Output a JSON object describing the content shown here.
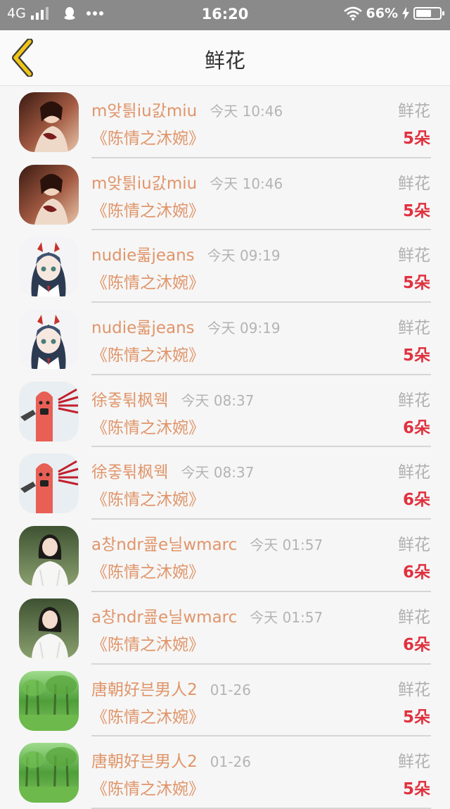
{
  "status_bar": {
    "network": "4G",
    "time": "16:20",
    "battery": "66%",
    "battery_level": 0.66,
    "icons": [
      "signal-icon",
      "qq-penguin-icon",
      "more-dots-icon",
      "wifi-icon",
      "charging-icon",
      "battery-icon"
    ]
  },
  "header": {
    "title": "鲜花",
    "back_icon": "chevron-left-icon",
    "accent_color": "#f0c419"
  },
  "colors": {
    "name": "#e0956a",
    "count": "#e0313f",
    "muted": "#b0b0b0"
  },
  "rows": [
    {
      "avatar": "avatar-girl-photo",
      "name": "m앚틝iu갌miu",
      "time": "今天 10:46",
      "book": "《陈情之沐婉》",
      "gift": "鲜花",
      "count": "5朵"
    },
    {
      "avatar": "avatar-girl-photo",
      "name": "m앚틝iu갌miu",
      "time": "今天 10:46",
      "book": "《陈情之沐婉》",
      "gift": "鲜花",
      "count": "5朵"
    },
    {
      "avatar": "avatar-anime-girl",
      "name": "nudie룳jeans",
      "time": "今天 09:19",
      "book": "《陈情之沐婉》",
      "gift": "鲜花",
      "count": "5朵"
    },
    {
      "avatar": "avatar-anime-girl",
      "name": "nudie룳jeans",
      "time": "今天 09:19",
      "book": "《陈情之沐婉》",
      "gift": "鲜花",
      "count": "5朵"
    },
    {
      "avatar": "avatar-finger-cartoon",
      "name": "徐줗튂枫웩",
      "time": "今天 08:37",
      "book": "《陈情之沐婉》",
      "gift": "鲜花",
      "count": "6朵"
    },
    {
      "avatar": "avatar-finger-cartoon",
      "name": "徐줗튂枫웩",
      "time": "今天 08:37",
      "book": "《陈情之沐婉》",
      "gift": "鲜花",
      "count": "6朵"
    },
    {
      "avatar": "avatar-woman-white",
      "name": "a창ndr쿒e닐wmarc",
      "time": "今天 01:57",
      "book": "《陈情之沐婉》",
      "gift": "鲜花",
      "count": "6朵"
    },
    {
      "avatar": "avatar-woman-white",
      "name": "a창ndr쿒e닐wmarc",
      "time": "今天 01:57",
      "book": "《陈情之沐婉》",
      "gift": "鲜花",
      "count": "6朵"
    },
    {
      "avatar": "avatar-forest",
      "name": "唐朝好븐男人2",
      "time": "01-26",
      "book": "《陈情之沐婉》",
      "gift": "鲜花",
      "count": "5朵"
    },
    {
      "avatar": "avatar-forest",
      "name": "唐朝好븐男人2",
      "time": "01-26",
      "book": "《陈情之沐婉》",
      "gift": "鲜花",
      "count": "5朵"
    }
  ]
}
